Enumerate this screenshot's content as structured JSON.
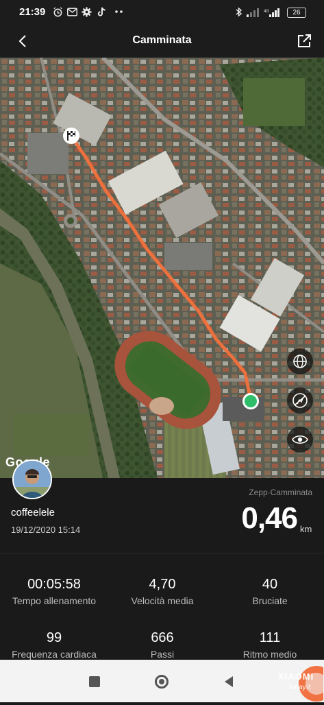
{
  "status_bar": {
    "time": "21:39",
    "battery": "26"
  },
  "header": {
    "title": "Camminata",
    "back_icon": "chevron-left-icon",
    "share_icon": "share-external-icon"
  },
  "map": {
    "attribution": "Google",
    "route_color": "#f2713c",
    "end_marker_color": "#2fbf6b",
    "controls": [
      "globe-icon",
      "no-walk-layer-icon",
      "eye-icon"
    ]
  },
  "activity": {
    "username": "coffeelele",
    "datetime": "19/12/2020 15:14",
    "source_label": "Zepp·Camminata",
    "distance": "0,46",
    "distance_unit": "km"
  },
  "stats": [
    {
      "value": "00:05:58",
      "label": "Tempo allenamento"
    },
    {
      "value": "4,70",
      "label": "Velocità media"
    },
    {
      "value": "40",
      "label": "Bruciate"
    },
    {
      "value": "99",
      "label": "Frequenza cardiaca"
    },
    {
      "value": "666",
      "label": "Passi"
    },
    {
      "value": "111",
      "label": "Ritmo medio"
    }
  ],
  "watermark": {
    "brand": "XIAOMI",
    "site": "today.it"
  },
  "nav_bar": [
    "recent-apps-icon",
    "home-icon",
    "back-icon"
  ]
}
